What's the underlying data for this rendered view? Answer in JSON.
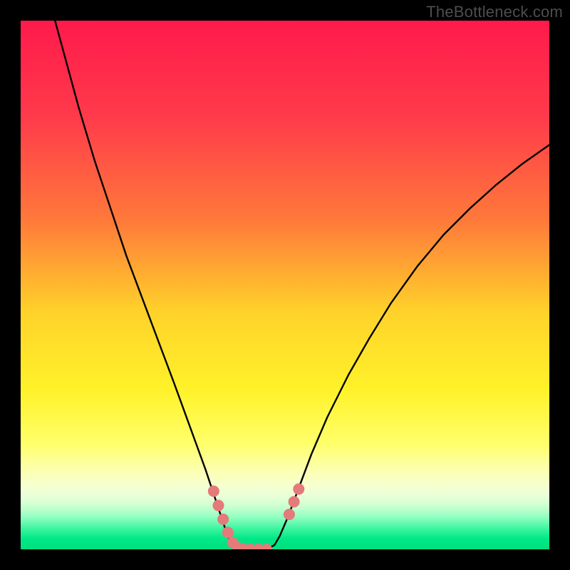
{
  "watermark": "TheBottleneck.com",
  "chart_data": {
    "type": "line",
    "title": "",
    "xlabel": "",
    "ylabel": "",
    "xlim": [
      0,
      100
    ],
    "ylim": [
      0,
      100
    ],
    "gradient_stops": [
      {
        "offset": 0,
        "color": "#ff1a4b"
      },
      {
        "offset": 18,
        "color": "#ff3a4b"
      },
      {
        "offset": 38,
        "color": "#ff7a3a"
      },
      {
        "offset": 55,
        "color": "#ffd22a"
      },
      {
        "offset": 70,
        "color": "#fff22a"
      },
      {
        "offset": 80,
        "color": "#ffff6a"
      },
      {
        "offset": 85,
        "color": "#fcffb0"
      },
      {
        "offset": 88,
        "color": "#f6ffd0"
      },
      {
        "offset": 90,
        "color": "#e8ffd8"
      },
      {
        "offset": 92,
        "color": "#c8ffd0"
      },
      {
        "offset": 94,
        "color": "#8effc0"
      },
      {
        "offset": 96,
        "color": "#40f5a0"
      },
      {
        "offset": 98,
        "color": "#00e887"
      },
      {
        "offset": 100,
        "color": "#00e07e"
      }
    ],
    "series": [
      {
        "name": "curve",
        "color": "#000000",
        "width": 2.4,
        "points": [
          {
            "x": 6.5,
            "y": 100.0
          },
          {
            "x": 8.0,
            "y": 94.5
          },
          {
            "x": 11.0,
            "y": 83.5
          },
          {
            "x": 14.0,
            "y": 73.5
          },
          {
            "x": 17.0,
            "y": 64.5
          },
          {
            "x": 20.0,
            "y": 55.5
          },
          {
            "x": 23.0,
            "y": 47.5
          },
          {
            "x": 26.0,
            "y": 39.5
          },
          {
            "x": 29.0,
            "y": 31.5
          },
          {
            "x": 31.0,
            "y": 26.0
          },
          {
            "x": 33.0,
            "y": 20.5
          },
          {
            "x": 35.0,
            "y": 15.0
          },
          {
            "x": 36.5,
            "y": 10.5
          },
          {
            "x": 38.0,
            "y": 6.0
          },
          {
            "x": 39.0,
            "y": 3.0
          },
          {
            "x": 40.0,
            "y": 0.8
          },
          {
            "x": 41.5,
            "y": 0.0
          },
          {
            "x": 44.0,
            "y": 0.0
          },
          {
            "x": 46.5,
            "y": 0.0
          },
          {
            "x": 48.0,
            "y": 0.8
          },
          {
            "x": 49.0,
            "y": 2.5
          },
          {
            "x": 50.5,
            "y": 6.0
          },
          {
            "x": 52.0,
            "y": 10.0
          },
          {
            "x": 55.0,
            "y": 18.0
          },
          {
            "x": 58.0,
            "y": 25.0
          },
          {
            "x": 62.0,
            "y": 33.0
          },
          {
            "x": 66.0,
            "y": 40.0
          },
          {
            "x": 70.0,
            "y": 46.5
          },
          {
            "x": 75.0,
            "y": 53.5
          },
          {
            "x": 80.0,
            "y": 59.5
          },
          {
            "x": 85.0,
            "y": 64.5
          },
          {
            "x": 90.0,
            "y": 69.0
          },
          {
            "x": 95.0,
            "y": 73.0
          },
          {
            "x": 100.0,
            "y": 76.5
          }
        ]
      },
      {
        "name": "markers-left",
        "color": "#e47a7a",
        "marker_radius": 8,
        "points": [
          {
            "x": 36.5,
            "y": 11.0
          },
          {
            "x": 37.4,
            "y": 8.3
          },
          {
            "x": 38.3,
            "y": 5.7
          },
          {
            "x": 39.2,
            "y": 3.2
          },
          {
            "x": 40.1,
            "y": 1.3
          },
          {
            "x": 41.1,
            "y": 0.3
          },
          {
            "x": 42.2,
            "y": 0.0
          },
          {
            "x": 43.5,
            "y": 0.0
          },
          {
            "x": 45.0,
            "y": 0.0
          },
          {
            "x": 46.5,
            "y": 0.0
          }
        ]
      },
      {
        "name": "markers-right",
        "color": "#e47a7a",
        "marker_radius": 8,
        "points": [
          {
            "x": 50.8,
            "y": 6.6
          },
          {
            "x": 51.7,
            "y": 9.0
          },
          {
            "x": 52.6,
            "y": 11.4
          }
        ]
      }
    ]
  }
}
